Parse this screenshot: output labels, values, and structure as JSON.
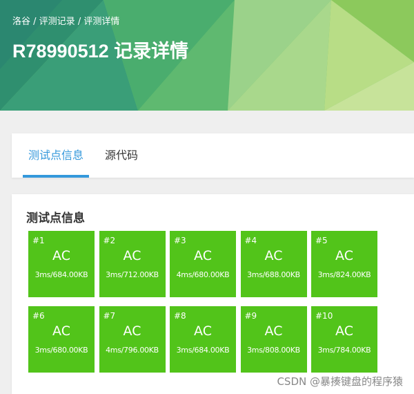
{
  "breadcrumb": {
    "root": "洛谷",
    "sep1": " / ",
    "records": "评测记录",
    "sep2": " / ",
    "current": "评测详情"
  },
  "page_title": "R78990512 记录详情",
  "tabs": [
    {
      "label": "测试点信息",
      "active": true
    },
    {
      "label": "源代码",
      "active": false
    }
  ],
  "testcases": {
    "title": "测试点信息",
    "color": "#52c41a",
    "items": [
      {
        "num": "#1",
        "status": "AC",
        "meta": "3ms/684.00KB"
      },
      {
        "num": "#2",
        "status": "AC",
        "meta": "3ms/712.00KB"
      },
      {
        "num": "#3",
        "status": "AC",
        "meta": "4ms/680.00KB"
      },
      {
        "num": "#4",
        "status": "AC",
        "meta": "3ms/688.00KB"
      },
      {
        "num": "#5",
        "status": "AC",
        "meta": "3ms/824.00KB"
      },
      {
        "num": "#6",
        "status": "AC",
        "meta": "3ms/680.00KB"
      },
      {
        "num": "#7",
        "status": "AC",
        "meta": "4ms/796.00KB"
      },
      {
        "num": "#8",
        "status": "AC",
        "meta": "3ms/684.00KB"
      },
      {
        "num": "#9",
        "status": "AC",
        "meta": "3ms/808.00KB"
      },
      {
        "num": "#10",
        "status": "AC",
        "meta": "3ms/784.00KB"
      }
    ]
  },
  "watermark": "CSDN @暴揍键盘的程序猿",
  "colors": {
    "accent": "#3498db",
    "banner_green": "#6fbf6a"
  }
}
